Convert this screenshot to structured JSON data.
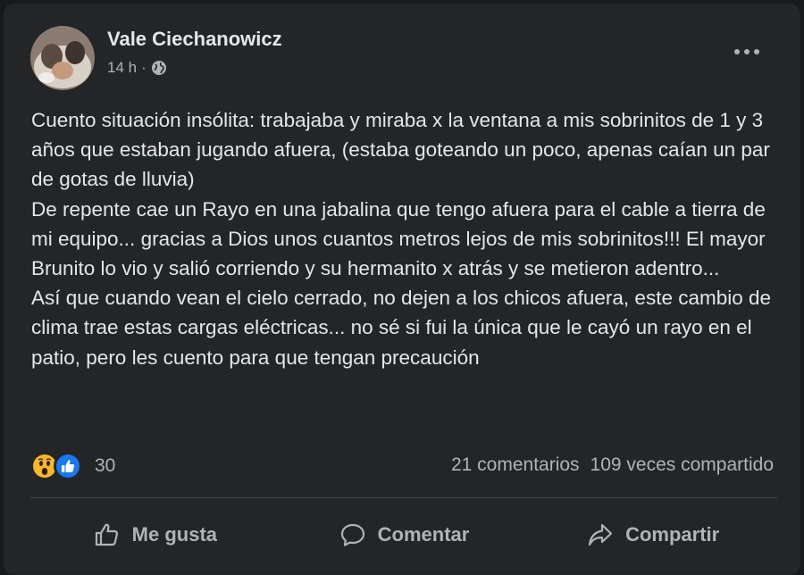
{
  "post": {
    "author": "Vale Ciechanowicz",
    "time": "14 h",
    "separator": "·",
    "privacy_icon": "globe-icon",
    "more_icon": "more-dots-icon",
    "paragraphs": [
      "Cuento situación insólita: trabajaba y miraba x la ventana a mis sobrinitos de 1 y 3 años que estaban jugando afuera, (estaba goteando un poco, apenas caían un par de gotas de lluvia)",
      "De repente cae un Rayo en una jabalina que tengo afuera para el cable a tierra de mi equipo... gracias a Dios unos cuantos metros lejos de mis sobrinitos!!! El mayor Brunito lo vio y salió corriendo y su hermanito x atrás y se metieron adentro...",
      "Así que cuando vean el cielo cerrado, no dejen a los chicos afuera, este cambio de clima trae estas cargas eléctricas... no sé si fui la única que le cayó un rayo en el patio, pero les cuento para que tengan precaución"
    ]
  },
  "reactions": {
    "icons": [
      "wow-reaction-icon",
      "like-reaction-icon"
    ],
    "count": "30",
    "comments": "21 comentarios",
    "shares": "109 veces compartido"
  },
  "actions": [
    {
      "label": "Me gusta",
      "icon": "thumbs-up-icon"
    },
    {
      "label": "Comentar",
      "icon": "comment-icon"
    },
    {
      "label": "Compartir",
      "icon": "share-icon"
    }
  ],
  "colors": {
    "card_bg": "#242526",
    "text_primary": "#e4e6eb",
    "text_secondary": "#b0b3b8",
    "like_blue": "#1877f2",
    "wow_yellow": "#f7b928"
  }
}
